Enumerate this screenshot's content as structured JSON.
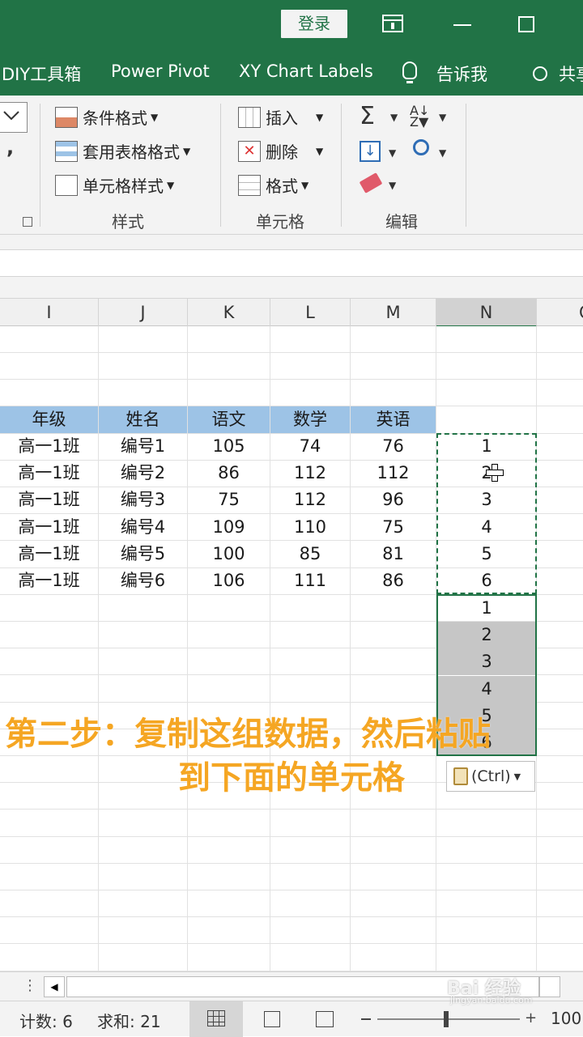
{
  "titlebar": {
    "login_label": "登录"
  },
  "menubar": {
    "items": [
      "DIY工具箱",
      "Power Pivot",
      "XY Chart Labels",
      "告诉我",
      "共享"
    ]
  },
  "ribbon": {
    "styles": {
      "conditional_format": "条件格式",
      "format_as_table": "套用表格格式",
      "cell_styles": "单元格样式",
      "group_label": "样式"
    },
    "cells": {
      "insert": "插入",
      "delete": "删除",
      "format": "格式",
      "group_label": "单元格"
    },
    "editing": {
      "group_label": "编辑"
    },
    "number_comma": ","
  },
  "columns": [
    "I",
    "J",
    "K",
    "L",
    "M",
    "N",
    "O"
  ],
  "table": {
    "headers": [
      "年级",
      "姓名",
      "语文",
      "数学",
      "英语"
    ],
    "rows": [
      [
        "高一1班",
        "编号1",
        "105",
        "74",
        "76",
        "1"
      ],
      [
        "高一1班",
        "编号2",
        "86",
        "112",
        "112",
        "2"
      ],
      [
        "高一1班",
        "编号3",
        "75",
        "112",
        "96",
        "3"
      ],
      [
        "高一1班",
        "编号4",
        "109",
        "110",
        "75",
        "4"
      ],
      [
        "高一1班",
        "编号5",
        "100",
        "85",
        "81",
        "5"
      ],
      [
        "高一1班",
        "编号6",
        "106",
        "111",
        "86",
        "6"
      ]
    ],
    "pasted": [
      "1",
      "2",
      "3",
      "4",
      "5",
      "6"
    ]
  },
  "paste_options": "(Ctrl)",
  "caption": {
    "line1": "第二步：复制这组数据，然后粘贴",
    "line2": "到下面的单元格"
  },
  "status": {
    "count": "计数: 6",
    "sum": "求和: 21",
    "zoom": "100"
  },
  "watermark": {
    "text": "Bai 经验",
    "sub": "jingyan.baidu.com"
  },
  "colors": {
    "excel_green": "#217346",
    "header_fill": "#9dc3e6",
    "selection": "#c6c6c6",
    "caption": "#f5a623"
  }
}
